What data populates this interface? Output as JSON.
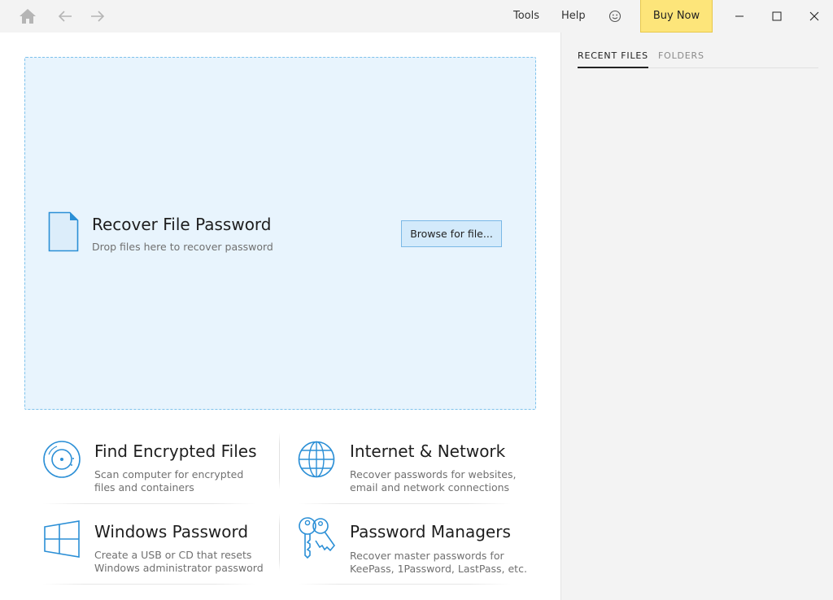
{
  "titlebar": {
    "icons": [
      "home-icon",
      "back-arrow-icon",
      "forward-arrow-icon",
      "smiley-icon",
      "minimize-icon",
      "maximize-icon",
      "close-icon"
    ],
    "tools_label": "Tools",
    "help_label": "Help",
    "buy_now_label": "Buy Now"
  },
  "dropzone": {
    "icon": "file-icon",
    "title": "Recover File Password",
    "subtitle": "Drop files here to recover password",
    "browse_label": "Browse for file..."
  },
  "tiles": [
    {
      "icon": "disc-icon",
      "title": "Find Encrypted Files",
      "desc_line1": "Scan computer for encrypted",
      "desc_line2": "files and containers"
    },
    {
      "icon": "globe-icon",
      "title": "Internet & Network",
      "desc_line1": "Recover passwords for websites,",
      "desc_line2": "email and network connections"
    },
    {
      "icon": "windows-logo-icon",
      "title": "Windows Password",
      "desc_line1": "Create a USB or CD that resets",
      "desc_line2": "Windows administrator password"
    },
    {
      "icon": "keys-icon",
      "title": "Password Managers",
      "desc_line1": "Recover master passwords for",
      "desc_line2": "KeePass, 1Password, LastPass, etc."
    }
  ],
  "side": {
    "tabs": [
      {
        "label": "RECENT FILES",
        "active": true
      },
      {
        "label": "FOLDERS",
        "active": false
      }
    ]
  },
  "colors": {
    "accent_blue": "#2b8fd6",
    "dropzone_bg": "#e8f4fd",
    "buy_now_bg": "#fde57a",
    "sidebar_bg": "#f3f3f3"
  }
}
